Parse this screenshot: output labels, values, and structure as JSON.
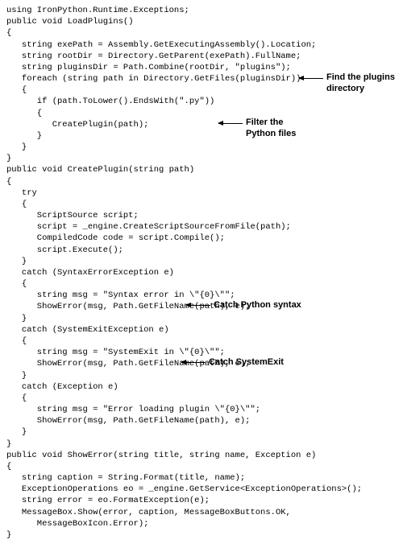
{
  "code": {
    "l00": "using IronPython.Runtime.Exceptions;",
    "l01": "",
    "l02": "public void LoadPlugins()",
    "l03": "{",
    "l04": "   string exePath = Assembly.GetExecutingAssembly().Location;",
    "l05": "   string rootDir = Directory.GetParent(exePath).FullName;",
    "l06": "   string pluginsDir = Path.Combine(rootDir, \"plugins\");",
    "l07": "",
    "l08": "   foreach (string path in Directory.GetFiles(pluginsDir))",
    "l09": "   {",
    "l10": "      if (path.ToLower().EndsWith(\".py\"))",
    "l11": "      {",
    "l12": "         CreatePlugin(path);",
    "l13": "      }",
    "l14": "   }",
    "l15": "}",
    "l16": "",
    "l17": "public void CreatePlugin(string path)",
    "l18": "{",
    "l19": "   try",
    "l20": "   {",
    "l21": "      ScriptSource script;",
    "l22": "      script = _engine.CreateScriptSourceFromFile(path);",
    "l23": "      CompiledCode code = script.Compile();",
    "l24": "      script.Execute();",
    "l25": "   }",
    "l26": "   catch (SyntaxErrorException e)",
    "l27": "   {",
    "l28": "      string msg = \"Syntax error in \\\"{0}\\\"\";",
    "l29": "      ShowError(msg, Path.GetFileName(path), e);",
    "l30": "   }",
    "l31": "   catch (SystemExitException e)",
    "l32": "   {",
    "l33": "      string msg = \"SystemExit in \\\"{0}\\\"\";",
    "l34": "      ShowError(msg, Path.GetFileName(path), e);",
    "l35": "   }",
    "l36": "   catch (Exception e)",
    "l37": "   {",
    "l38": "      string msg = \"Error loading plugin \\\"{0}\\\"\";",
    "l39": "      ShowError(msg, Path.GetFileName(path), e);",
    "l40": "   }",
    "l41": "}",
    "l42": "",
    "l43": "public void ShowError(string title, string name, Exception e)",
    "l44": "{",
    "l45": "   string caption = String.Format(title, name);",
    "l46": "   ExceptionOperations eo = _engine.GetService<ExceptionOperations>();",
    "l47": "   string error = eo.FormatException(e);",
    "l48": "   MessageBox.Show(error, caption, MessageBoxButtons.OK,",
    "l49": "      MessageBoxIcon.Error);",
    "l50": "}"
  },
  "annotations": {
    "a1_line1": "Find the plugins",
    "a1_line2": "directory",
    "a2_line1": "Filter the",
    "a2_line2": "Python files",
    "a3": "Catch Python syntax",
    "a4": "Catch SystemExit"
  }
}
